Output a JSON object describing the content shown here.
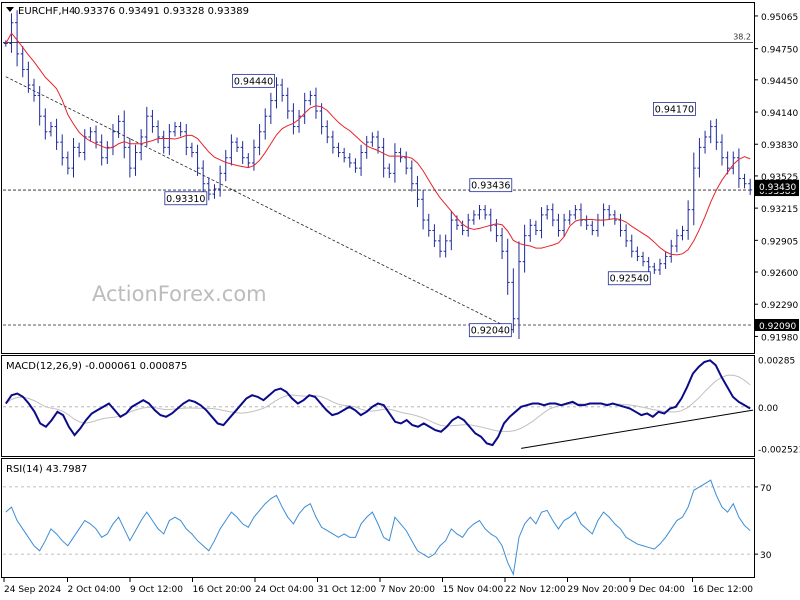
{
  "header": {
    "symbol_tf": "EURCHF,H4",
    "ohlc": "0.93376 0.93491 0.93328 0.93389"
  },
  "watermark": "ActionForex.com",
  "colors": {
    "price": "#1f2a9a",
    "ma": "#e8232b",
    "macd_line": "#0b0b8a",
    "macd_signal": "#c0c0c0",
    "rsi": "#3c8dd6",
    "dashed": "#222222",
    "label_box": "#1f2a9a"
  },
  "chart_data": [
    {
      "type": "candlestick",
      "title": "EURCHF,H4",
      "ylim": [
        0.9183,
        0.9518
      ],
      "y_ticks": [
        "0.95065",
        "0.94750",
        "0.94450",
        "0.94140",
        "0.93830",
        "0.93525",
        "0.93215",
        "0.92905",
        "0.92600",
        "0.92290",
        "0.91980"
      ],
      "x_ticks": [
        "24 Sep 2024",
        "2 Oct 04:00",
        "9 Oct 12:00",
        "16 Oct 20:00",
        "24 Oct 04:00",
        "31 Oct 12:00",
        "7 Nov 20:00",
        "15 Nov 04:00",
        "22 Nov 12:00",
        "29 Nov 20:00",
        "9 Dec 04:00",
        "16 Dec 12:00"
      ],
      "current_price": {
        "value": 0.93389,
        "label": "0.93389"
      },
      "ma_last": {
        "value": 0.9343,
        "label": "0.93430"
      },
      "fib": {
        "value": 0.9481,
        "label": "38.2"
      },
      "support": {
        "value": 0.9209,
        "label": "0.92090"
      },
      "price_labels": [
        {
          "text": "0.94440",
          "x_index": 48,
          "value": 0.9444
        },
        {
          "text": "0.93310",
          "x_index": 36,
          "value": 0.9331
        },
        {
          "text": "0.93436",
          "x_index": 86,
          "value": 0.93436
        },
        {
          "text": "0.92040",
          "x_index": 90,
          "value": 0.9204
        },
        {
          "text": "0.92540",
          "x_index": 115,
          "value": 0.9254
        },
        {
          "text": "0.94170",
          "x_index": 123,
          "value": 0.9417
        }
      ],
      "trendline": {
        "from": {
          "x_index": 0,
          "value": 0.9448
        },
        "to": {
          "x_index": 90,
          "value": 0.9204
        }
      },
      "series": [
        {
          "name": "",
          "values": [
            0.948,
            0.95,
            0.947,
            0.9455,
            0.944,
            0.943,
            0.941,
            0.9395,
            0.94,
            0.9385,
            0.937,
            0.936,
            0.938,
            0.9375,
            0.939,
            0.9395,
            0.9385,
            0.937,
            0.938,
            0.9395,
            0.9405,
            0.938,
            0.936,
            0.9375,
            0.939,
            0.941,
            0.94,
            0.939,
            0.938,
            0.9395,
            0.94,
            0.9395,
            0.938,
            0.9375,
            0.936,
            0.9345,
            0.9335,
            0.934,
            0.9355,
            0.937,
            0.9385,
            0.938,
            0.937,
            0.9365,
            0.938,
            0.9395,
            0.941,
            0.9425,
            0.944,
            0.943,
            0.9415,
            0.94,
            0.941,
            0.9425,
            0.943,
            0.9415,
            0.94,
            0.939,
            0.938,
            0.9375,
            0.937,
            0.9365,
            0.936,
            0.9375,
            0.9385,
            0.939,
            0.938,
            0.936,
            0.9355,
            0.9375,
            0.937,
            0.936,
            0.9345,
            0.933,
            0.931,
            0.93,
            0.929,
            0.928,
            0.929,
            0.931,
            0.9305,
            0.93,
            0.931,
            0.9315,
            0.932,
            0.9315,
            0.9305,
            0.9295,
            0.928,
            0.925,
            0.9215,
            0.927,
            0.9295,
            0.9305,
            0.93,
            0.9315,
            0.932,
            0.931,
            0.93,
            0.931,
            0.9315,
            0.932,
            0.931,
            0.9305,
            0.93,
            0.931,
            0.932,
            0.9315,
            0.931,
            0.93,
            0.929,
            0.928,
            0.9275,
            0.927,
            0.9265,
            0.9262,
            0.9268,
            0.9275,
            0.9285,
            0.9295,
            0.93,
            0.932,
            0.936,
            0.938,
            0.939,
            0.94,
            0.9385,
            0.937,
            0.936,
            0.937,
            0.935,
            0.9345,
            0.9339
          ]
        },
        {
          "name": "",
          "role": "moving average",
          "values": []
        }
      ]
    },
    {
      "type": "line",
      "title": "MACD(12,26,9) -0.000061 0.000875",
      "ylim": [
        -0.0029,
        0.003
      ],
      "y_ticks": [
        "0.00285",
        "0.00",
        "-0.002521"
      ],
      "series": [
        {
          "name": "MACD(12,26,9)",
          "values": [
            0.0002,
            0.0007,
            0.0008,
            0.0006,
            0.0002,
            -0.0003,
            -0.001,
            -0.0012,
            -0.0008,
            -0.0003,
            -0.0005,
            -0.0012,
            -0.0017,
            -0.0013,
            -0.0008,
            -0.0004,
            -0.0002,
            0.0,
            0.0002,
            -0.0002,
            -0.0006,
            -0.0004,
            0.0,
            0.0002,
            0.0004,
            0.0002,
            -0.0002,
            -0.0005,
            -0.0006,
            -0.0004,
            -0.0001,
            0.0002,
            0.0004,
            0.0003,
            0.0001,
            -0.0002,
            -0.0006,
            -0.001,
            -0.0011,
            -0.0007,
            -0.0003,
            0.0001,
            0.0005,
            0.0007,
            0.0006,
            0.0004,
            0.0007,
            0.001,
            0.0011,
            0.0009,
            0.0005,
            0.0002,
            0.0004,
            0.0007,
            0.0006,
            0.0002,
            -0.0002,
            -0.0005,
            -0.0004,
            -0.0002,
            0.0,
            -0.0002,
            -0.0005,
            -0.0003,
            0.0,
            0.0002,
            0.0001,
            -0.0004,
            -0.0009,
            -0.001,
            -0.0008,
            -0.0011,
            -0.0012,
            -0.001,
            -0.0012,
            -0.0014,
            -0.0015,
            -0.0012,
            -0.0008,
            -0.0006,
            -0.0008,
            -0.0012,
            -0.0016,
            -0.0018,
            -0.0022,
            -0.0023,
            -0.0018,
            -0.001,
            -0.0006,
            -0.0003,
            0.0,
            0.0001,
            0.0002,
            0.0002,
            0.0001,
            0.0002,
            0.0002,
            0.0001,
            0.0002,
            0.0003,
            0.0001,
            0.0001,
            0.0002,
            0.0002,
            0.0002,
            0.0001,
            0.0002,
            0.0001,
            0.0,
            -0.0001,
            -0.0003,
            -0.0005,
            -0.0004,
            -0.0006,
            -0.0003,
            -0.0004,
            -0.0001,
            0.0,
            0.0005,
            0.0012,
            0.002,
            0.0024,
            0.0027,
            0.0028,
            0.0025,
            0.0018,
            0.0012,
            0.0006,
            0.0003,
            0.0001,
            -0.0001
          ]
        },
        {
          "name": "signal",
          "values": []
        }
      ],
      "trendline": {
        "from": {
          "x_index": 90,
          "value": -0.0025
        },
        "to": {
          "x_index": 134,
          "value": -0.0002
        }
      }
    },
    {
      "type": "line",
      "title": "RSI(14) 43.7987",
      "ylim": [
        17,
        86
      ],
      "y_ticks": [
        "70",
        "30"
      ],
      "levels": [
        70,
        30
      ],
      "series": [
        {
          "name": "RSI(14)",
          "values": [
            55,
            58,
            50,
            45,
            40,
            35,
            32,
            38,
            45,
            42,
            38,
            35,
            40,
            45,
            50,
            48,
            45,
            40,
            42,
            48,
            52,
            45,
            38,
            44,
            50,
            55,
            50,
            45,
            42,
            50,
            52,
            50,
            45,
            42,
            38,
            35,
            32,
            38,
            45,
            50,
            55,
            52,
            48,
            46,
            52,
            56,
            60,
            63,
            65,
            58,
            52,
            48,
            54,
            58,
            60,
            52,
            46,
            44,
            42,
            40,
            42,
            40,
            40,
            48,
            52,
            55,
            48,
            40,
            38,
            52,
            48,
            44,
            38,
            32,
            30,
            28,
            30,
            35,
            38,
            45,
            42,
            40,
            45,
            48,
            50,
            45,
            42,
            40,
            35,
            25,
            18,
            40,
            48,
            52,
            48,
            55,
            56,
            50,
            45,
            50,
            52,
            55,
            48,
            45,
            42,
            50,
            55,
            52,
            48,
            45,
            40,
            38,
            36,
            35,
            34,
            33,
            36,
            40,
            45,
            50,
            52,
            58,
            68,
            70,
            72,
            74,
            65,
            58,
            55,
            60,
            52,
            47,
            44
          ]
        }
      ]
    }
  ]
}
